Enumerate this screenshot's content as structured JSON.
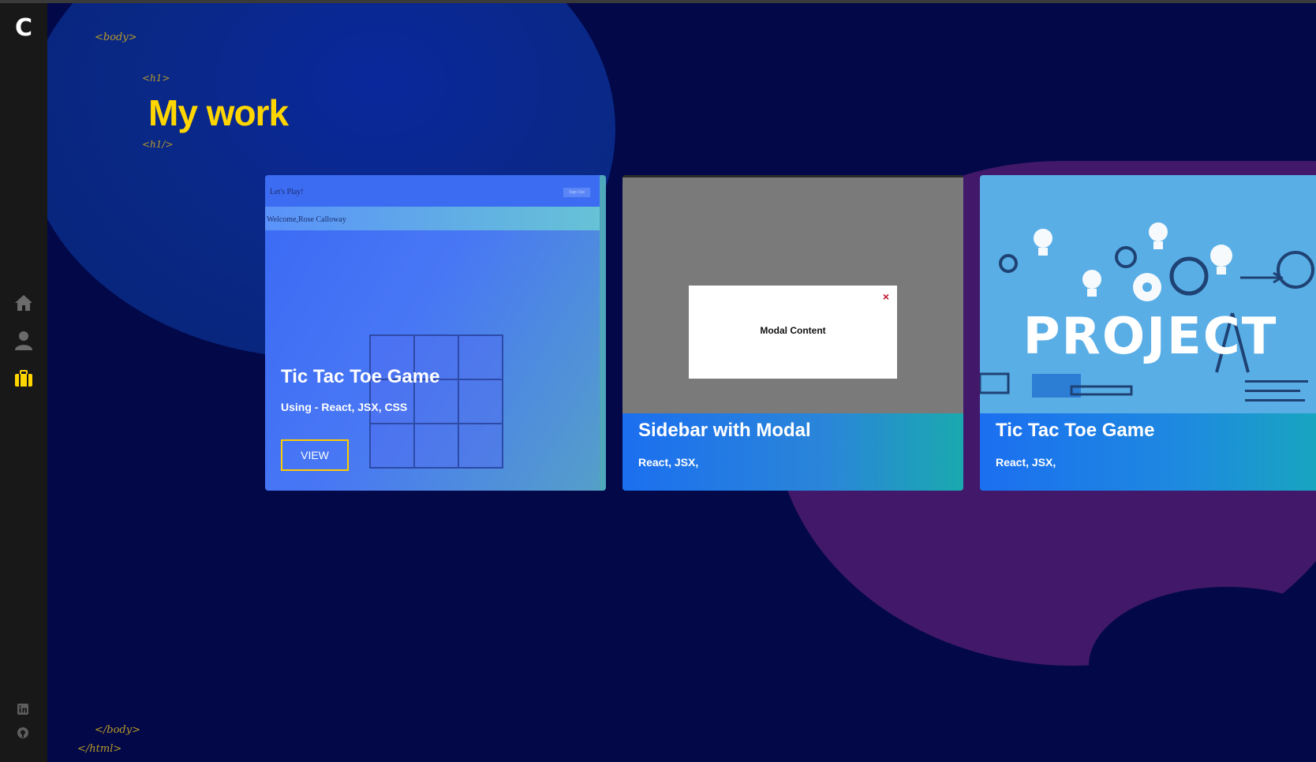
{
  "sidebar": {
    "logo": "C",
    "nav": [
      {
        "name": "home-icon",
        "active": false
      },
      {
        "name": "user-icon",
        "active": false
      },
      {
        "name": "briefcase-icon",
        "active": true
      }
    ],
    "social": [
      "linkedin-icon",
      "github-icon"
    ]
  },
  "tags": {
    "body_open": "<body>",
    "h1_open": "<h1>",
    "h1_close": "<h1/>",
    "body_close": "</body>",
    "html_close": "</html>"
  },
  "page": {
    "title": "My work"
  },
  "cards": [
    {
      "title": "Tic Tac Toe Game",
      "subtitle": "Using - React, JSX, CSS",
      "button": "VIEW",
      "preview": {
        "bar_text": "Let's Play!",
        "bar_button": "Sign Out",
        "welcome": "Welcome,Rose Calloway"
      }
    },
    {
      "title": "Sidebar with Modal",
      "subtitle": "React, JSX,",
      "preview": {
        "modal_text": "Modal Content",
        "close": "×"
      }
    },
    {
      "title": "Tic Tac Toe Game",
      "subtitle": "React, JSX,",
      "preview": {
        "image_word": "PROJECT"
      }
    }
  ],
  "colors": {
    "accent": "#ffd600",
    "background": "#020848",
    "sidebar": "#181818"
  }
}
